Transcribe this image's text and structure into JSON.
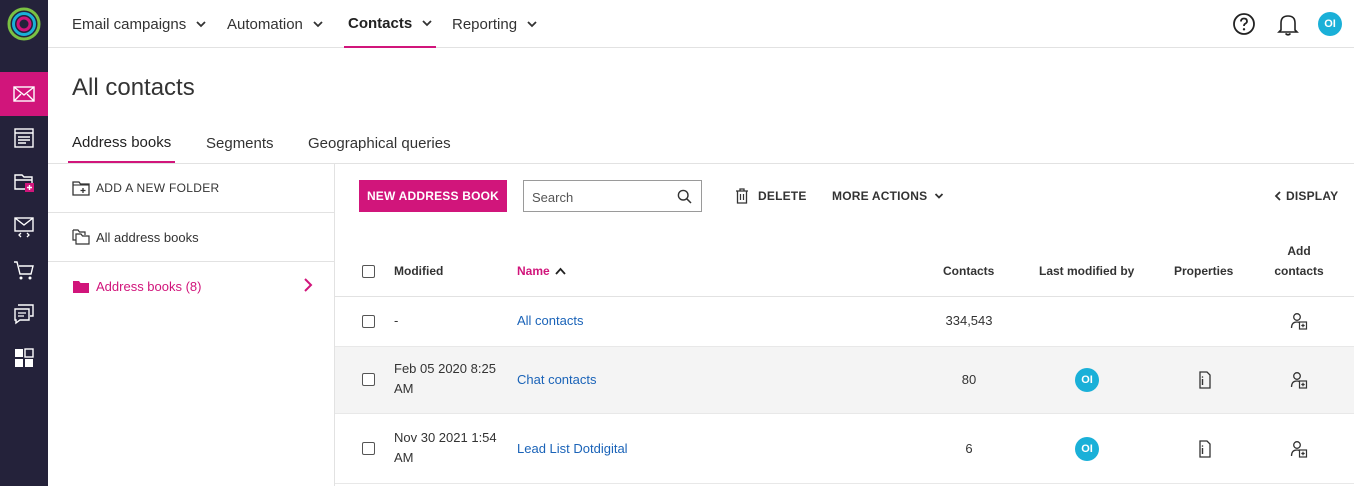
{
  "nav": {
    "items": [
      {
        "label": "Email campaigns"
      },
      {
        "label": "Automation"
      },
      {
        "label": "Contacts",
        "active": true
      },
      {
        "label": "Reporting"
      }
    ],
    "user_initials": "OI"
  },
  "rail": {
    "items": [
      "mail-icon",
      "newsletter-icon",
      "forms-icon",
      "transactional-mail-icon",
      "cart-icon",
      "chat-icon",
      "apps-icon"
    ],
    "active": "mail-icon"
  },
  "page": {
    "title": "All contacts",
    "tabs": [
      "Address books",
      "Segments",
      "Geographical queries"
    ],
    "active_tab": "Address books"
  },
  "folders": {
    "add_label": "ADD A NEW FOLDER",
    "all_label": "All address books",
    "selected_label": "Address books (8)"
  },
  "toolbar": {
    "new_label": "NEW ADDRESS BOOK",
    "search_placeholder": "Search",
    "delete_label": "DELETE",
    "more_label": "MORE ACTIONS",
    "display_label": "DISPLAY"
  },
  "table": {
    "headers": {
      "modified": "Modified",
      "name": "Name",
      "contacts": "Contacts",
      "last_modified_by": "Last modified by",
      "properties": "Properties",
      "add_contacts_1": "Add",
      "add_contacts_2": "contacts"
    },
    "rows": [
      {
        "modified_1": "-",
        "modified_2": "",
        "name": "All contacts",
        "contacts": "334,543",
        "modified_by": ""
      },
      {
        "modified_1": "Feb 05 2020 8:25",
        "modified_2": "AM",
        "name": "Chat contacts",
        "contacts": "80",
        "modified_by": "OI"
      },
      {
        "modified_1": "Nov 30 2021 1:54",
        "modified_2": "AM",
        "name": "Lead List Dotdigital",
        "contacts": "6",
        "modified_by": "OI"
      }
    ]
  },
  "colors": {
    "accent": "#d1157b",
    "rail": "#24223a",
    "link": "#1a63b8",
    "avatar": "#1ab0d8"
  }
}
